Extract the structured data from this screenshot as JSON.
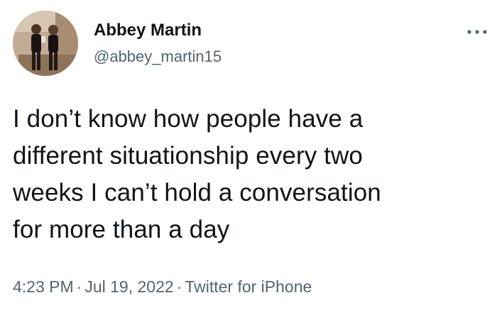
{
  "user": {
    "display_name": "Abbey Martin",
    "handle": "@abbey_martin15",
    "avatar_icon": "profile-photo"
  },
  "tweet": {
    "text_lines": [
      "I don’t know how people have a",
      "different situationship every two",
      "weeks I can’t hold a conversation",
      "for more than a day"
    ]
  },
  "meta": {
    "time": "4:23 PM",
    "separator": "·",
    "date": "Jul 19, 2022",
    "source": "Twitter for iPhone"
  },
  "actions": {
    "more_icon": "more-horizontal-icon"
  },
  "colors": {
    "primary_text": "#0f1419",
    "secondary_text": "#536471",
    "background": "#ffffff"
  }
}
